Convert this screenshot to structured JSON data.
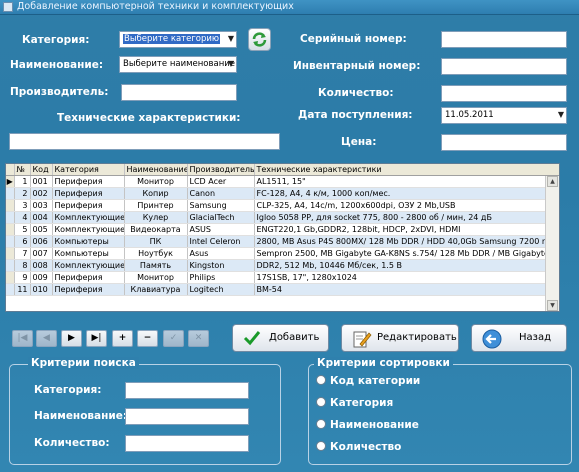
{
  "window": {
    "title": "Добавление компьютерной техники и комплектующих"
  },
  "form": {
    "category_label": "Категория:",
    "category_value": "Выберите категорию",
    "name_label": "Наименование:",
    "name_value": "Выберите наименование",
    "manufacturer_label": "Производитель:",
    "manufacturer_value": "",
    "specs_label": "Технические характеристики:",
    "specs_value": "",
    "serial_label": "Серийный номер:",
    "serial_value": "",
    "inventory_label": "Инвентарный номер:",
    "inventory_value": "",
    "quantity_label": "Количество:",
    "quantity_value": "",
    "date_label": "Дата поступления:",
    "date_value": "11.05.2011",
    "price_label": "Цена:",
    "price_value": ""
  },
  "grid": {
    "columns": [
      "№",
      "Код",
      "Категория",
      "Наименование",
      "Производитель",
      "Технические характеристики"
    ],
    "rows": [
      [
        "1",
        "001",
        "Периферия",
        "Монитор",
        "LCD Acer",
        "AL1511, 15\""
      ],
      [
        "2",
        "002",
        "Периферия",
        "Копир",
        "Canon",
        "FC-128, A4, 4 к/м, 1000 коп/мес."
      ],
      [
        "3",
        "003",
        "Периферия",
        "Принтер",
        "Samsung",
        "CLP-325, A4, 14c/m, 1200x600dpi, ОЗУ 2 Mb,USB"
      ],
      [
        "4",
        "004",
        "Комплектующие",
        "Кулер",
        "GlacialTech",
        "Igloo 5058 PP, для socket 775, 800 - 2800 об / мин, 24 дБ"
      ],
      [
        "5",
        "005",
        "Комплектующие",
        "Видеокарта",
        "ASUS",
        "ENGT220,1 Gb,GDDR2, 128bit, HDCP, 2xDVI, HDMI"
      ],
      [
        "6",
        "006",
        "Компьютеры",
        "ПК",
        "Intel Celeron",
        "2800, MB Asus P4S 800MX/ 128 Mb DDR / HDD 40,0Gb Samsung 7200 rpm/ FD"
      ],
      [
        "7",
        "007",
        "Компьютеры",
        "Ноутбук",
        "Asus",
        "Sempron 2500, MB Gigabyte GA-K8NS s.754/ 128 Mb DDR / MB Gigabyte GA-K8"
      ],
      [
        "8",
        "008",
        "Комплектующие",
        "Память",
        "Kingston",
        "DDR2, 512 Mb, 10446 Мб/сек, 1.5 В"
      ],
      [
        "9",
        "009",
        "Периферия",
        "Монитор",
        "Philips",
        "17S1SB, 17\", 1280x1024"
      ],
      [
        "11",
        "010",
        "Периферия",
        "Клавиатура",
        "Logitech",
        "BM-54"
      ]
    ]
  },
  "buttons": {
    "add": "Добавить",
    "edit": "Редактировать",
    "back": "Назад"
  },
  "search": {
    "title": "Критерии поиска",
    "category_label": "Категория:",
    "name_label": "Наименование:",
    "quantity_label": "Количество:"
  },
  "sort": {
    "title": "Критерии сортировки",
    "options": [
      "Код категории",
      "Категория",
      "Наименование",
      "Количество"
    ]
  }
}
